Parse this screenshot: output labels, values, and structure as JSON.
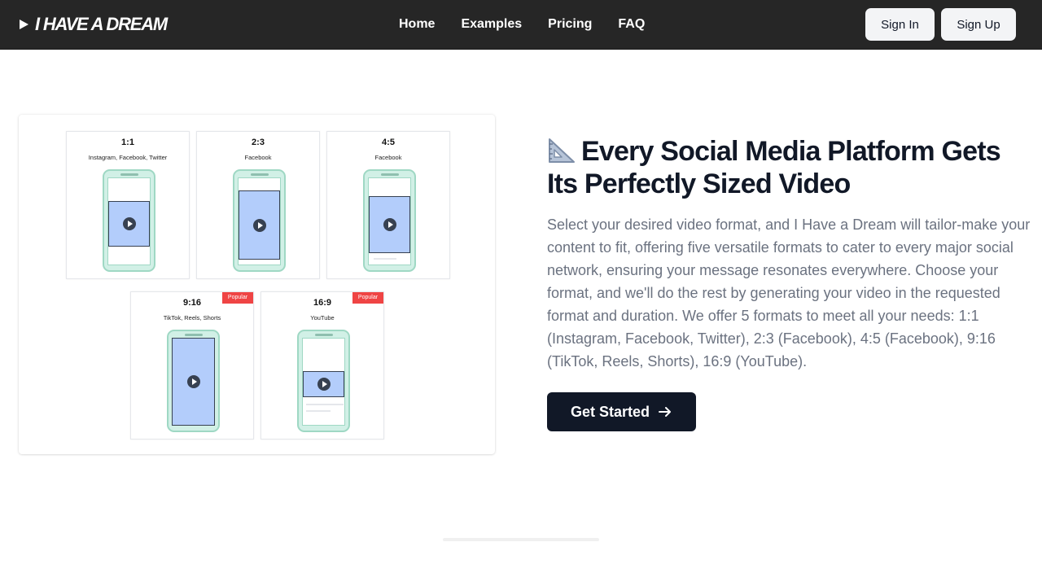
{
  "brand": {
    "logo_text": "I HAVE A DREAM",
    "logo_icon": "play-icon"
  },
  "nav": {
    "links": [
      "Home",
      "Examples",
      "Pricing",
      "FAQ"
    ],
    "sign_in": "Sign In",
    "sign_up": "Sign Up"
  },
  "formats": [
    {
      "ratio": "1:1",
      "platforms": "Instagram, Facebook, Twitter",
      "badge": ""
    },
    {
      "ratio": "2:3",
      "platforms": "Facebook",
      "badge": ""
    },
    {
      "ratio": "4:5",
      "platforms": "Facebook",
      "badge": ""
    },
    {
      "ratio": "9:16",
      "platforms": "TikTok, Reels, Shorts",
      "badge": "Popular"
    },
    {
      "ratio": "16:9",
      "platforms": "YouTube",
      "badge": "Popular"
    }
  ],
  "hero": {
    "icon": "triangular-ruler-icon",
    "heading": "Every Social Media Platform Gets Its Perfectly Sized Video",
    "description": "Select your desired video format, and I Have a Dream will tailor-make your content to fit, offering five versatile formats to cater to every major social network, ensuring your message resonates everywhere. Choose your format, and we'll do the rest by generating your video in the requested format and duration. We offer 5 formats to meet all your needs: 1:1 (Instagram, Facebook, Twitter), 2:3 (Facebook), 4:5 (Facebook), 9:16 (TikTok, Reels, Shorts), 16:9 (YouTube).",
    "cta": "Get Started",
    "cta_icon": "arrow-right-icon"
  },
  "colors": {
    "nav_bg": "#262626",
    "cta_bg": "#111827",
    "phone_fill": "#d1f0e6",
    "video_fill": "#b3cdfb",
    "badge": "#ef4444"
  }
}
